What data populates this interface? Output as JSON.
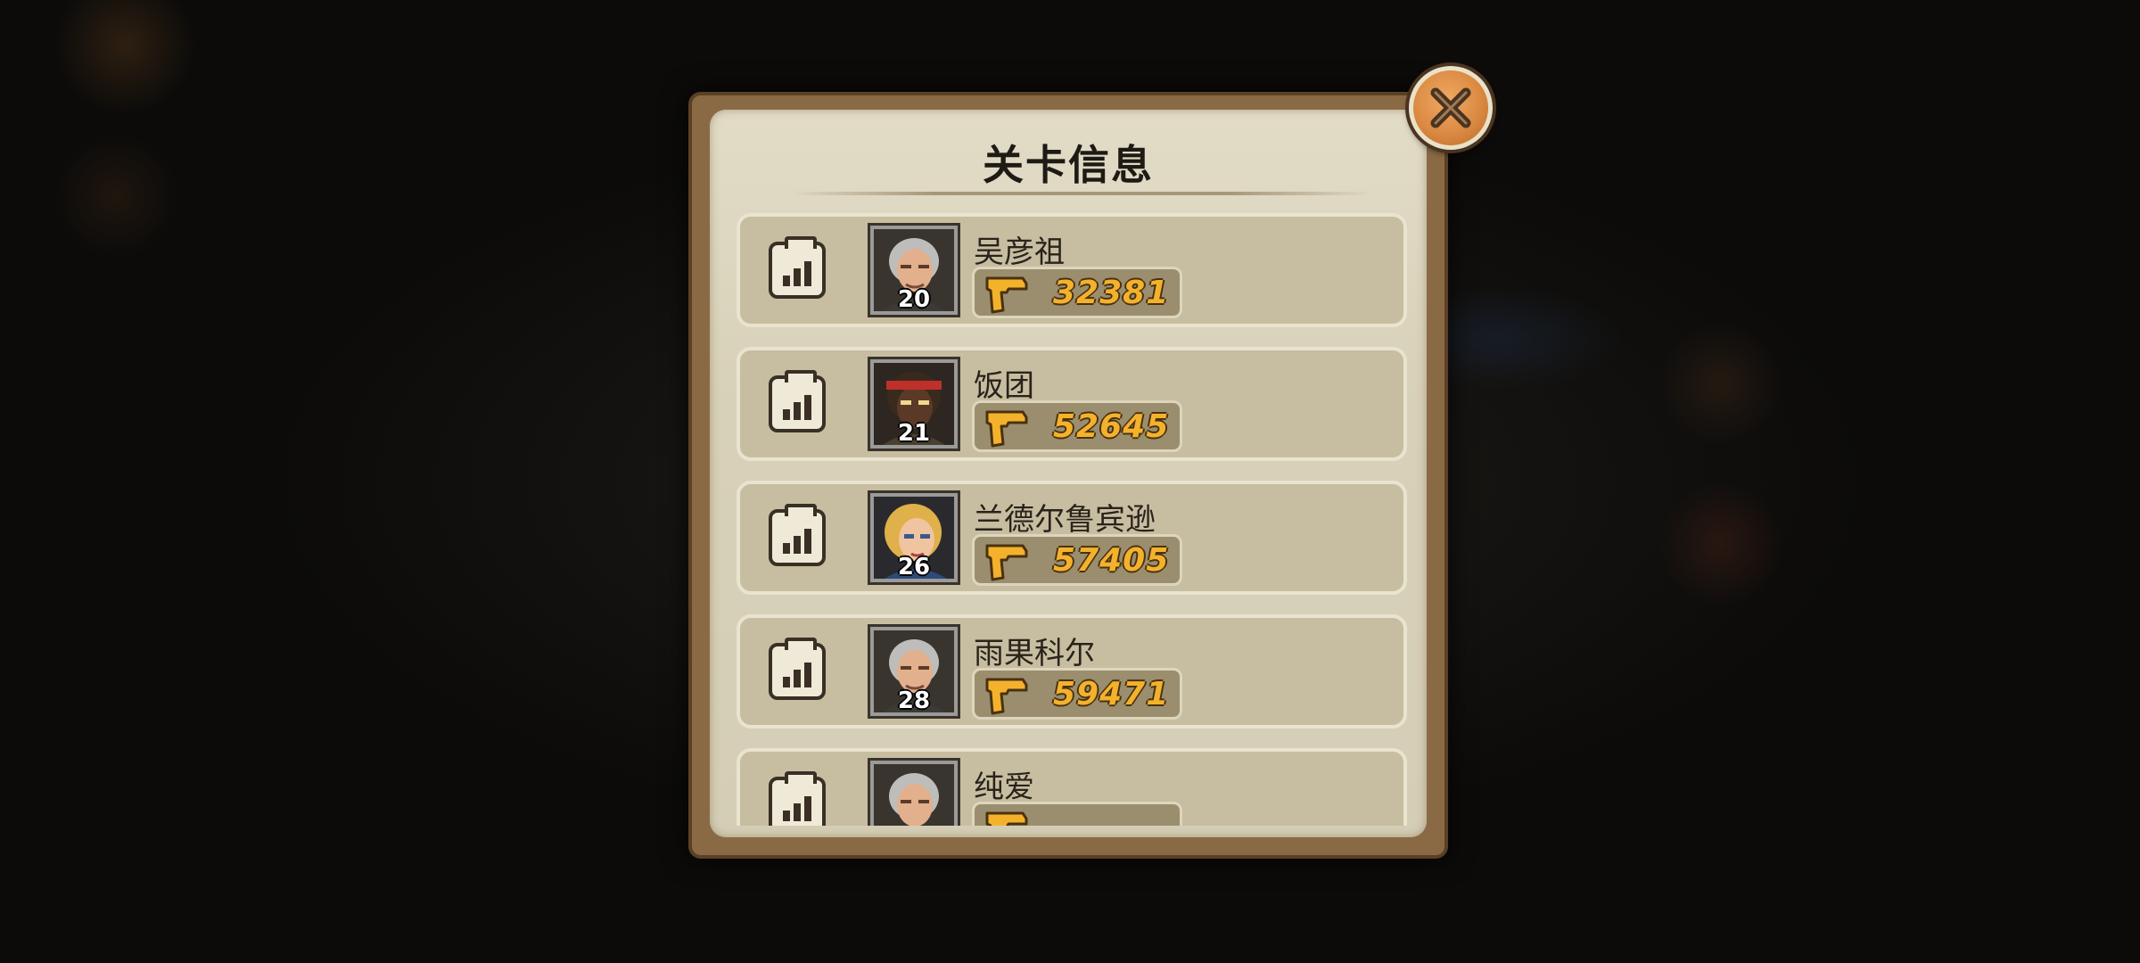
{
  "dialog": {
    "title": "关卡信息",
    "close_icon": "close-x-icon"
  },
  "players": [
    {
      "name": "吴彦祖",
      "level": "20",
      "power": "32381",
      "avatar": "gray-haired-man"
    },
    {
      "name": "饭团",
      "level": "21",
      "power": "52645",
      "avatar": "dark-skinned-red-headband"
    },
    {
      "name": "兰德尔鲁宾逊",
      "level": "26",
      "power": "57405",
      "avatar": "blonde-woman"
    },
    {
      "name": "雨果科尔",
      "level": "28",
      "power": "59471",
      "avatar": "gray-haired-man"
    },
    {
      "name": "纯爱",
      "level": "",
      "power": "",
      "avatar": "gray-haired-man"
    }
  ],
  "icons": {
    "stats": "bar-chart-clipboard-icon",
    "power": "pistol-icon"
  },
  "colors": {
    "power_text": "#f4b22c",
    "panel_bg": "#d8d1b9",
    "close_button": "#db8a43"
  }
}
